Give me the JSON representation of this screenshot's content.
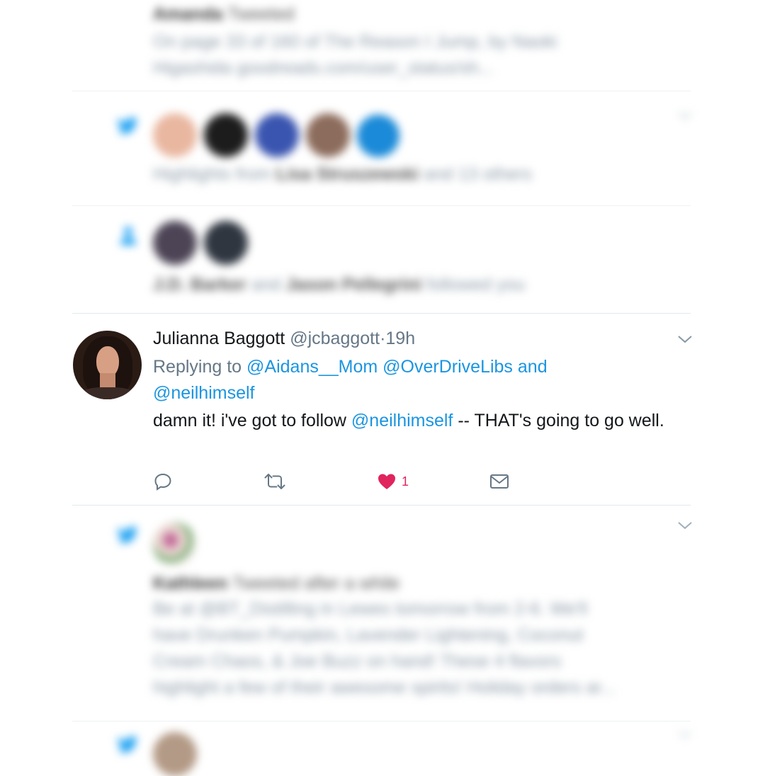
{
  "colors": {
    "accent": "#1b95e0",
    "like": "#e0245e",
    "text": "#14171a",
    "muted": "#657786"
  },
  "blurred_rows": [
    {
      "title_bold": "Amanda",
      "title_rest": " Tweeted",
      "text": [
        "On page 33 of 160 of The Reason I Jump, by Naoki",
        "Higashida goodreads.com/user_status/sh..."
      ]
    },
    {
      "summary_pre": "Highlights from ",
      "summary_bold": "Lisa Struszewski",
      "summary_post": " and 13 others"
    },
    {
      "summary_bold_a": "J.D. Barker",
      "summary_mid": " and ",
      "summary_bold_b": "Jason Pellegrini",
      "summary_post": " followed you"
    },
    {
      "title_bold": "Kathleen",
      "title_rest": " Tweeted after a while",
      "text": [
        "Be at @BT_Distilling in Lewes tomorrow from 2-6. We'll",
        "have Drunken Pumpkin, Lavender Lightening, Coconut",
        "Cream Chaos, & Joe Buzz on hand! These 4 flavors",
        "highlight a few of their awesome spirits! Holiday orders ar..."
      ]
    }
  ],
  "tweet": {
    "name": "Julianna Baggott",
    "handle": "@jcbaggott",
    "sep": "·",
    "time": "19h",
    "replying_prefix": "Replying to ",
    "mention_1": "@Aidans__Mom",
    "mention_2": "@OverDriveLibs",
    "and": " and ",
    "mention_3": "@neilhimself",
    "body_pre": "damn it! i've got to follow ",
    "body_mention": "@neilhimself",
    "body_post": " -- THAT's going to go well.",
    "like_count": "1"
  },
  "icons": {
    "reply": "reply-bubble-icon",
    "retweet": "retweet-icon",
    "like": "heart-icon",
    "dm": "envelope-icon",
    "caret": "chevron-down-icon",
    "bird": "twitter-bird-icon",
    "follow": "person-icon"
  }
}
